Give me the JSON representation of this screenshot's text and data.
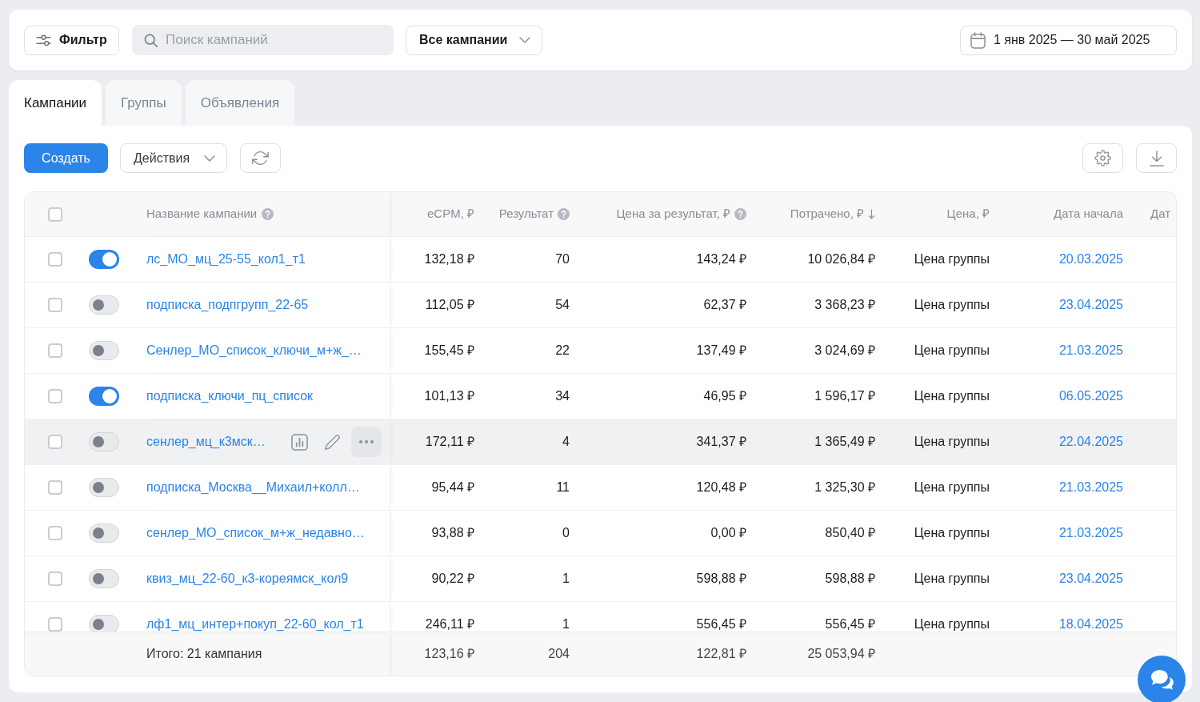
{
  "filter_bar": {
    "filter_button": "Фильтр",
    "search": {
      "placeholder": "Поиск кампаний"
    },
    "campaign_select": "Все кампании",
    "date_range": "1 янв 2025 — 30 май 2025"
  },
  "tabs": [
    {
      "label": "Кампании",
      "selected": true
    },
    {
      "label": "Группы",
      "selected": false
    },
    {
      "label": "Объявления",
      "selected": false
    }
  ],
  "toolbar": {
    "create_button": "Создать",
    "actions_menu": "Действия"
  },
  "table": {
    "select_all": {
      "checked": false
    },
    "columns": [
      {
        "label": "Название кампании",
        "help": true,
        "sorted": false
      },
      {
        "label": "eCPM, ₽",
        "help": false,
        "sorted": false
      },
      {
        "label": "Результат",
        "help": true,
        "sorted": false
      },
      {
        "label": "Цена за результат, ₽",
        "help": true,
        "sorted": false
      },
      {
        "label": "Потрачено, ₽",
        "help": false,
        "sorted": true
      },
      {
        "label": "Цена, ₽",
        "help": false,
        "sorted": false
      },
      {
        "label": "Дата начала",
        "help": false,
        "sorted": false
      },
      {
        "label": "Дат",
        "help": false,
        "sorted": false
      }
    ],
    "rows": [
      {
        "checked": false,
        "on": true,
        "hovered": false,
        "cells": [
          "лс_МО_мц_25-55_кол1_т1",
          "132,18 ₽",
          "70",
          "143,24 ₽",
          "10 026,84 ₽",
          "Цена группы",
          "20.03.2025"
        ]
      },
      {
        "checked": false,
        "on": false,
        "hovered": false,
        "cells": [
          "подписка_подпгрупп_22-65",
          "112,05 ₽",
          "54",
          "62,37 ₽",
          "3 368,23 ₽",
          "Цена группы",
          "23.04.2025"
        ]
      },
      {
        "checked": false,
        "on": false,
        "hovered": false,
        "cells": [
          "Сенлер_МО_список_ключи_м+ж_…",
          "155,45 ₽",
          "22",
          "137,49 ₽",
          "3 024,69 ₽",
          "Цена группы",
          "21.03.2025"
        ]
      },
      {
        "checked": false,
        "on": true,
        "hovered": false,
        "cells": [
          "подписка_ключи_пц_список",
          "101,13 ₽",
          "34",
          "46,95 ₽",
          "1 596,17 ₽",
          "Цена группы",
          "06.05.2025"
        ]
      },
      {
        "checked": false,
        "on": false,
        "hovered": true,
        "cells": [
          "сенлер_мц_к3мск…",
          "172,11 ₽",
          "4",
          "341,37 ₽",
          "1 365,49 ₽",
          "Цена группы",
          "22.04.2025"
        ]
      },
      {
        "checked": false,
        "on": false,
        "hovered": false,
        "cells": [
          "подписка_Москва__Михаил+колл…",
          "95,44 ₽",
          "11",
          "120,48 ₽",
          "1 325,30 ₽",
          "Цена группы",
          "21.03.2025"
        ]
      },
      {
        "checked": false,
        "on": false,
        "hovered": false,
        "cells": [
          "сенлер_МО_список_м+ж_недавно…",
          "93,88 ₽",
          "0",
          "0,00 ₽",
          "850,40 ₽",
          "Цена группы",
          "21.03.2025"
        ]
      },
      {
        "checked": false,
        "on": false,
        "hovered": false,
        "cells": [
          "квиз_мц_22-60_к3-кореямск_кол9",
          "90,22 ₽",
          "1",
          "598,88 ₽",
          "598,88 ₽",
          "Цена группы",
          "23.04.2025"
        ]
      },
      {
        "checked": false,
        "on": false,
        "hovered": false,
        "cells": [
          "лф1_мц_интер+покуп_22-60_кол_т1",
          "246,11 ₽",
          "1",
          "556,45 ₽",
          "556,45 ₽",
          "Цена группы",
          "18.04.2025"
        ]
      }
    ],
    "totals": {
      "label": "Итого: 21 кампания",
      "cells": [
        "123,16 ₽",
        "204",
        "122,81 ₽",
        "25 053,94 ₽"
      ]
    }
  }
}
